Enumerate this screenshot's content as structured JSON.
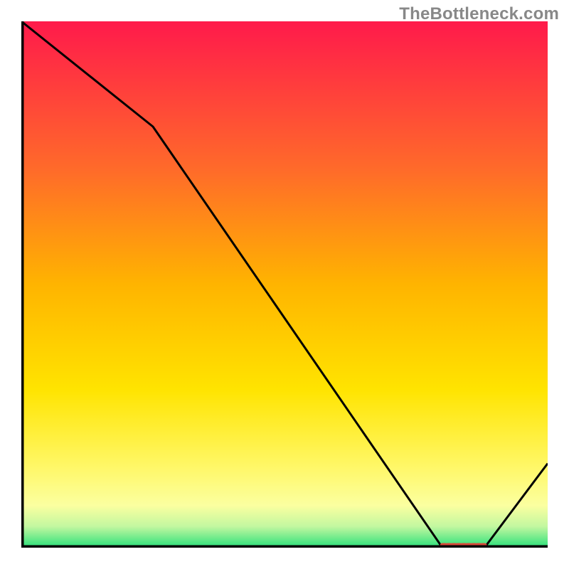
{
  "watermark": "TheBottleneck.com",
  "chart_data": {
    "type": "line",
    "title": "",
    "xlabel": "",
    "ylabel": "",
    "xlim": [
      0,
      100
    ],
    "ylim": [
      0,
      100
    ],
    "x": [
      0,
      25,
      80,
      88,
      100
    ],
    "values": [
      100,
      80,
      0,
      0,
      16
    ],
    "marker_segment": {
      "x_start": 80,
      "x_end": 88,
      "y": 0
    },
    "gradient_stops": [
      {
        "offset": 0,
        "color": "#ff1a4b"
      },
      {
        "offset": 28,
        "color": "#ff6a2a"
      },
      {
        "offset": 50,
        "color": "#ffb400"
      },
      {
        "offset": 70,
        "color": "#ffe400"
      },
      {
        "offset": 85,
        "color": "#fff86a"
      },
      {
        "offset": 92,
        "color": "#fbffa0"
      },
      {
        "offset": 96,
        "color": "#c2f7a0"
      },
      {
        "offset": 100,
        "color": "#29e07a"
      }
    ],
    "colors": {
      "curve": "#000000",
      "frame": "#000000",
      "marker": "#d84a3a"
    }
  }
}
